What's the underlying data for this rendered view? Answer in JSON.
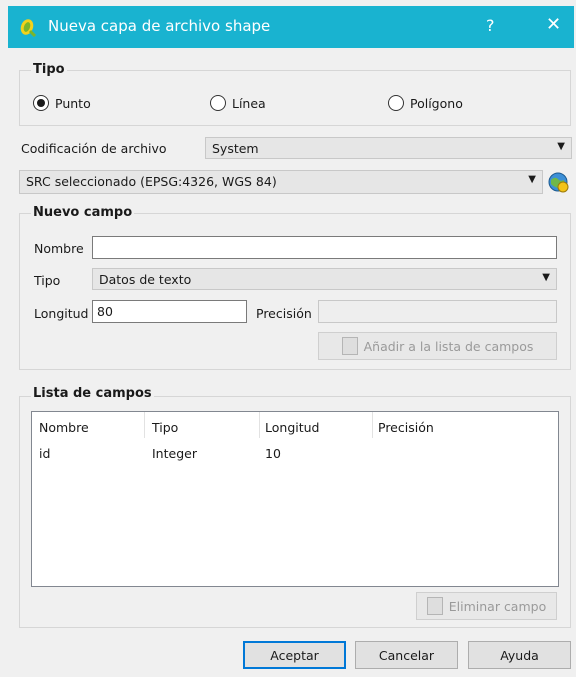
{
  "window": {
    "title": "Nueva capa de archivo shape",
    "help_label": "?",
    "close_label": "✕"
  },
  "tipo": {
    "title": "Tipo",
    "options": [
      {
        "label": "Punto",
        "checked": true
      },
      {
        "label": "Línea",
        "checked": false
      },
      {
        "label": "Polígono",
        "checked": false
      }
    ]
  },
  "encoding": {
    "label": "Codificación de archivo",
    "value": "System"
  },
  "crs": {
    "value": "SRC seleccionado (EPSG:4326, WGS 84)"
  },
  "nuevo_campo": {
    "title": "Nuevo campo",
    "nombre_label": "Nombre",
    "nombre_value": "",
    "tipo_label": "Tipo",
    "tipo_value": "Datos de texto",
    "longitud_label": "Longitud",
    "longitud_value": "80",
    "precision_label": "Precisión",
    "precision_value": "",
    "add_button": "Añadir a la lista de campos"
  },
  "lista_campos": {
    "title": "Lista de campos",
    "columns": [
      "Nombre",
      "Tipo",
      "Longitud",
      "Precisión"
    ],
    "rows": [
      [
        "id",
        "Integer",
        "10",
        ""
      ]
    ],
    "remove_button": "Eliminar campo"
  },
  "buttons": {
    "ok": "Aceptar",
    "cancel": "Cancelar",
    "help": "Ayuda"
  },
  "colors": {
    "titlebar": "#19b3d0",
    "accent": "#0078d7"
  }
}
